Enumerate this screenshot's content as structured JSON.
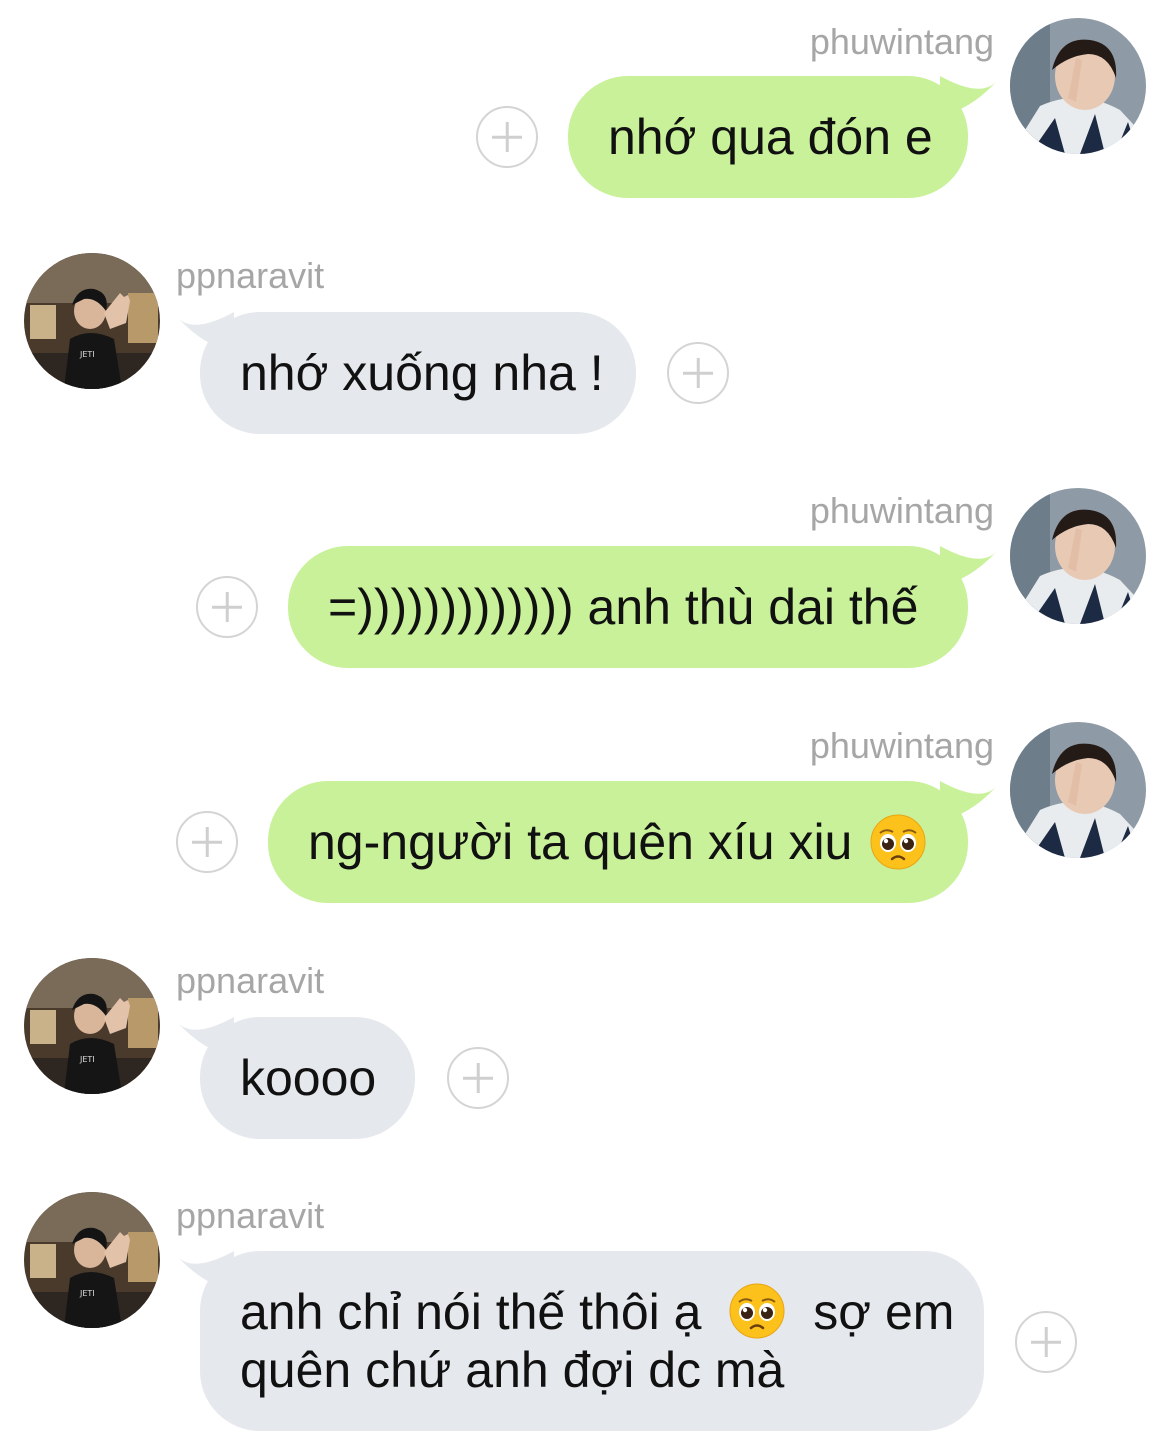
{
  "users": {
    "sender": "phuwintang",
    "receiver": "ppnaravit"
  },
  "colors": {
    "sent_bubble": "#c8f19a",
    "received_bubble": "#e5e8ec",
    "username": "#a6a6a6",
    "text": "#111111"
  },
  "icons": {
    "add_reaction": "plus-circle-icon",
    "pleading_face": "pleading-face-emoji"
  },
  "messages": [
    {
      "direction": "sent",
      "username": "phuwintang",
      "text": "nhớ qua đón e"
    },
    {
      "direction": "received",
      "username": "ppnaravit",
      "text": "nhớ xuống nha !"
    },
    {
      "direction": "sent",
      "username": "phuwintang",
      "text": "=))))))))))))) anh thù dai thế"
    },
    {
      "direction": "sent",
      "username": "phuwintang",
      "text": "ng-người ta quên xíu xiu"
    },
    {
      "direction": "received",
      "username": "ppnaravit",
      "text": "koooo"
    },
    {
      "direction": "received",
      "username": "ppnaravit",
      "line1_a": "anh chỉ nói thế thôi ạ",
      "line1_b": "sợ em",
      "line2": "quên chứ anh đợi dc mà"
    }
  ]
}
